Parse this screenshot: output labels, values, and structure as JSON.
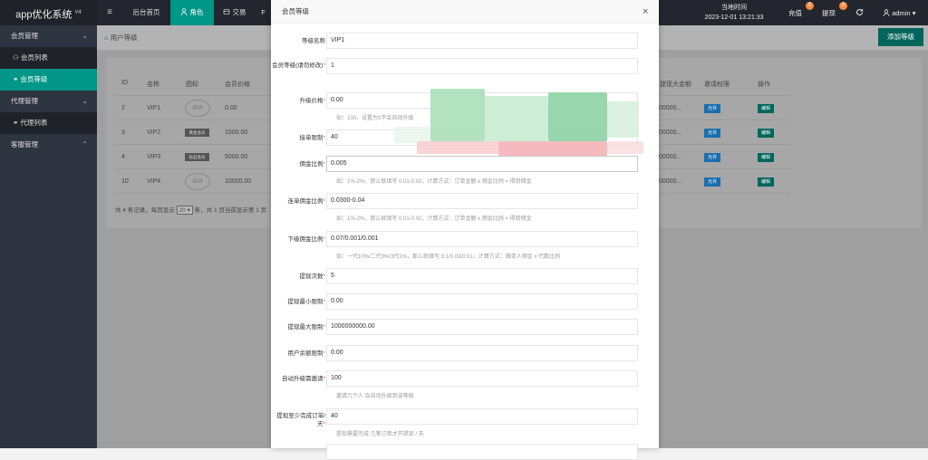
{
  "app": {
    "name": "app优化系统",
    "version": "V4"
  },
  "topnav": {
    "menu_icon": "≡",
    "tabs": [
      {
        "label": "后台首页"
      },
      {
        "label": "角色",
        "icon": "user-icon"
      },
      {
        "label": "交易",
        "icon": "coins-icon"
      },
      {
        "label": "F"
      }
    ],
    "time_label": "当地时间",
    "time_value": "2023-12-01 13:21:33",
    "recharge": {
      "label": "充值",
      "badge": "0"
    },
    "withdraw": {
      "label": "提现",
      "badge": "0"
    },
    "refresh_icon": "refresh-icon",
    "user": "admin",
    "user_caret": "▾"
  },
  "sidebar": {
    "items": [
      {
        "label": "会员管理",
        "arrow": "⌄"
      },
      {
        "label": "会员列表",
        "icon": "user-icon"
      },
      {
        "label": "会员等级",
        "icon": "link-icon"
      },
      {
        "label": "代理管理",
        "arrow": "⌄"
      },
      {
        "label": "代理列表",
        "icon": "link-icon"
      },
      {
        "label": "客服管理",
        "arrow": "⌃"
      }
    ]
  },
  "breadcrumb": {
    "label": "用户等级"
  },
  "add_button": "添加等级",
  "table": {
    "headers": [
      "ID",
      "名称",
      "图标",
      "会员价格",
      "提现大金额",
      "邀请权限",
      "操作"
    ],
    "rows": [
      {
        "id": "2",
        "name": "VIP1",
        "icon": "404",
        "price": "0.00",
        "max": "00000...",
        "perm": "允许",
        "op": "编辑"
      },
      {
        "id": "3",
        "name": "VIP2",
        "icon_tag": "黄金会员",
        "price": "1500.00",
        "max": "00000...",
        "perm": "允许",
        "op": "编辑"
      },
      {
        "id": "4",
        "name": "VIP3",
        "icon_tag": "钻石会员",
        "price": "5000.00",
        "max": "00000...",
        "perm": "允许",
        "op": "编辑"
      },
      {
        "id": "10",
        "name": "VIP4",
        "icon": "404",
        "price": "10000.00",
        "max": "00000...",
        "perm": "允许",
        "op": "编辑"
      }
    ],
    "pager_prefix": "共 4 条记录，每页显示",
    "pager_size": "20",
    "pager_suffix": "条，共 1 页当前显示第 1 页"
  },
  "modal": {
    "title": "会员等级",
    "close": "×",
    "fields": [
      {
        "label": "等级名称",
        "required": false,
        "value": "VIP1"
      },
      {
        "label": "会员等级(请勿修改)",
        "required": true,
        "value": "1"
      },
      {
        "label": "升级价格",
        "required": true,
        "value": "0.00",
        "hint": "如：100，设置为0不会自动升级"
      },
      {
        "label": "接单限制",
        "required": true,
        "value": "40"
      },
      {
        "label": "佣金比例",
        "required": true,
        "value": "0.005",
        "hint": "如：1%-2%，那么就填写 0.01-0.02，计算方式：订单金额 x 佣金比例 = 得到佣金"
      },
      {
        "label": "连单佣金比例",
        "required": true,
        "value": "0.0300-0.04",
        "hint": "如：1%-2%，那么就填写 0.01-0.02，计算方式：订单金额 x 佣金比例 = 得到佣金"
      },
      {
        "label": "下级佣金比例",
        "required": true,
        "value": "0.07/0.001/0.001",
        "hint": "如：一代10%/二代3%/3代1%，那么就填写 0.1/0.03/0.01；计算方式：做单人佣金 x 代数比例"
      },
      {
        "label": "提现次数",
        "required": true,
        "value": "5"
      },
      {
        "label": "提现最小限制",
        "required": true,
        "value": "0.00"
      },
      {
        "label": "提现最大限制",
        "required": true,
        "value": "1000000000.00"
      },
      {
        "label": "用户余额限制",
        "required": true,
        "value": "0.00"
      },
      {
        "label": "自动升级需邀请",
        "required": true,
        "value": "100",
        "hint": "邀请几个人 会自动升级到该等级"
      },
      {
        "label": "提现至少完成订单/天",
        "required": true,
        "value": "40",
        "hint": "提现需要完成 几笔订单才开提现 / 天"
      }
    ]
  },
  "colors": {
    "accent": "#009688",
    "required": "#ff5722",
    "dark": "#23262e"
  }
}
